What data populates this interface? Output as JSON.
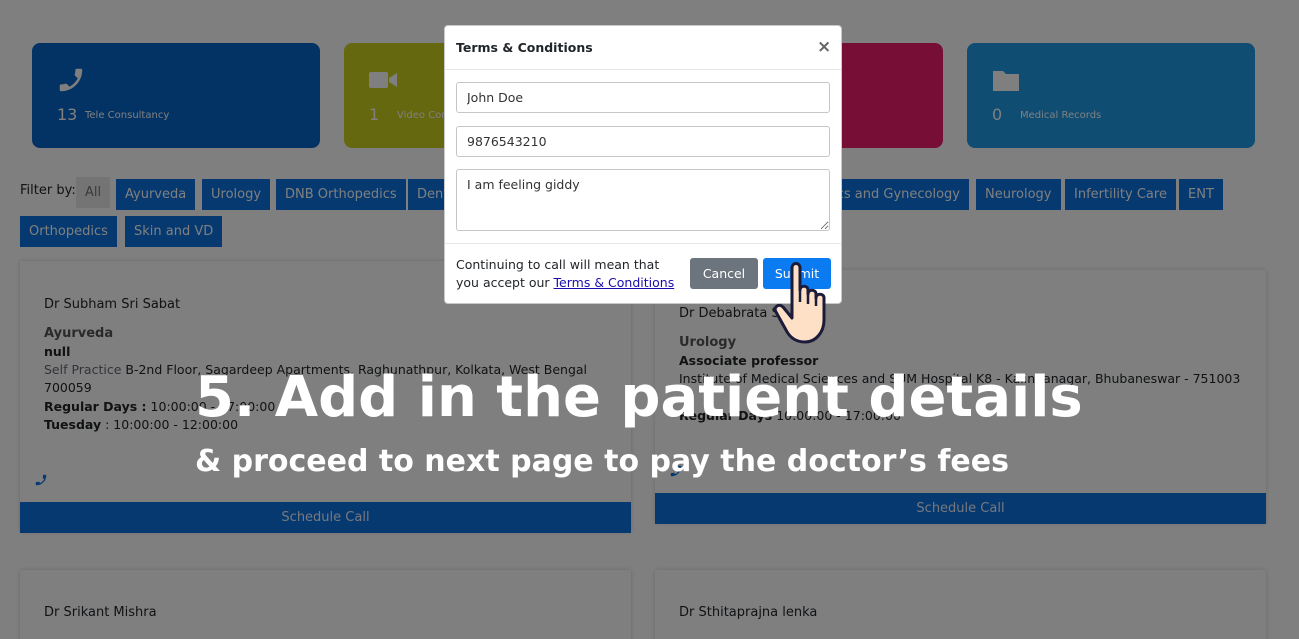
{
  "stats": [
    {
      "count": "13",
      "label": "Tele Consultancy",
      "icon": "phone-icon"
    },
    {
      "count": "1",
      "label": "Video Consultancy",
      "icon": "video-camera-icon"
    },
    {
      "count": "",
      "label": "",
      "icon": ""
    },
    {
      "count": "0",
      "label": "Medical Records",
      "icon": "folder-icon"
    }
  ],
  "filter": {
    "label": "Filter by:",
    "chips": [
      "All",
      "Ayurveda",
      "Urology",
      "DNB Orthopedics",
      "Dental",
      "Obstetrics and Gynecology",
      "Neurology",
      "Infertility Care",
      "ENT",
      "Orthopedics",
      "Skin and VD"
    ]
  },
  "doctors": [
    {
      "name": "Dr Subham Sri Sabat",
      "specialty": "Ayurveda",
      "designation": "null",
      "practice_label": "Self Practice",
      "address": "B-2nd Floor, Sagardeep Apartments, Raghunathpur, Kolkata, West Bengal 700059",
      "days_label": "Regular Days :",
      "days_time": "10:00:00 - 17:00:00",
      "day2_label": "Tuesday",
      "day2_time": ": 10:00:00 - 12:00:00",
      "button": "Schedule Call"
    },
    {
      "name": "Dr Debabrata S",
      "specialty": "Urology",
      "designation": "Associate professor",
      "address": "Institute of Medical Sciences and SUM Hospital K8 - Kalinganagar, Bhubaneswar - 751003",
      "days_label": "Regular Days",
      "days_time": "10:00:00 - 17:00:00",
      "button": "Schedule Call"
    },
    {
      "name": "Dr Srikant Mishra"
    },
    {
      "name": "Dr Sthitaprajna lenka"
    }
  ],
  "modal": {
    "title": "Terms & Conditions",
    "close": "×",
    "name_value": "John Doe",
    "phone_value": "9876543210",
    "message_value": "I am feeling giddy",
    "note_prefix": "Continuing to call will mean that you accept our",
    "note_link": "Terms & Conditions",
    "cancel": "Cancel",
    "submit": "Submit"
  },
  "caption": {
    "title": "5. Add in the patient details",
    "subtitle": "& proceed to next page to pay the doctor’s fees"
  }
}
